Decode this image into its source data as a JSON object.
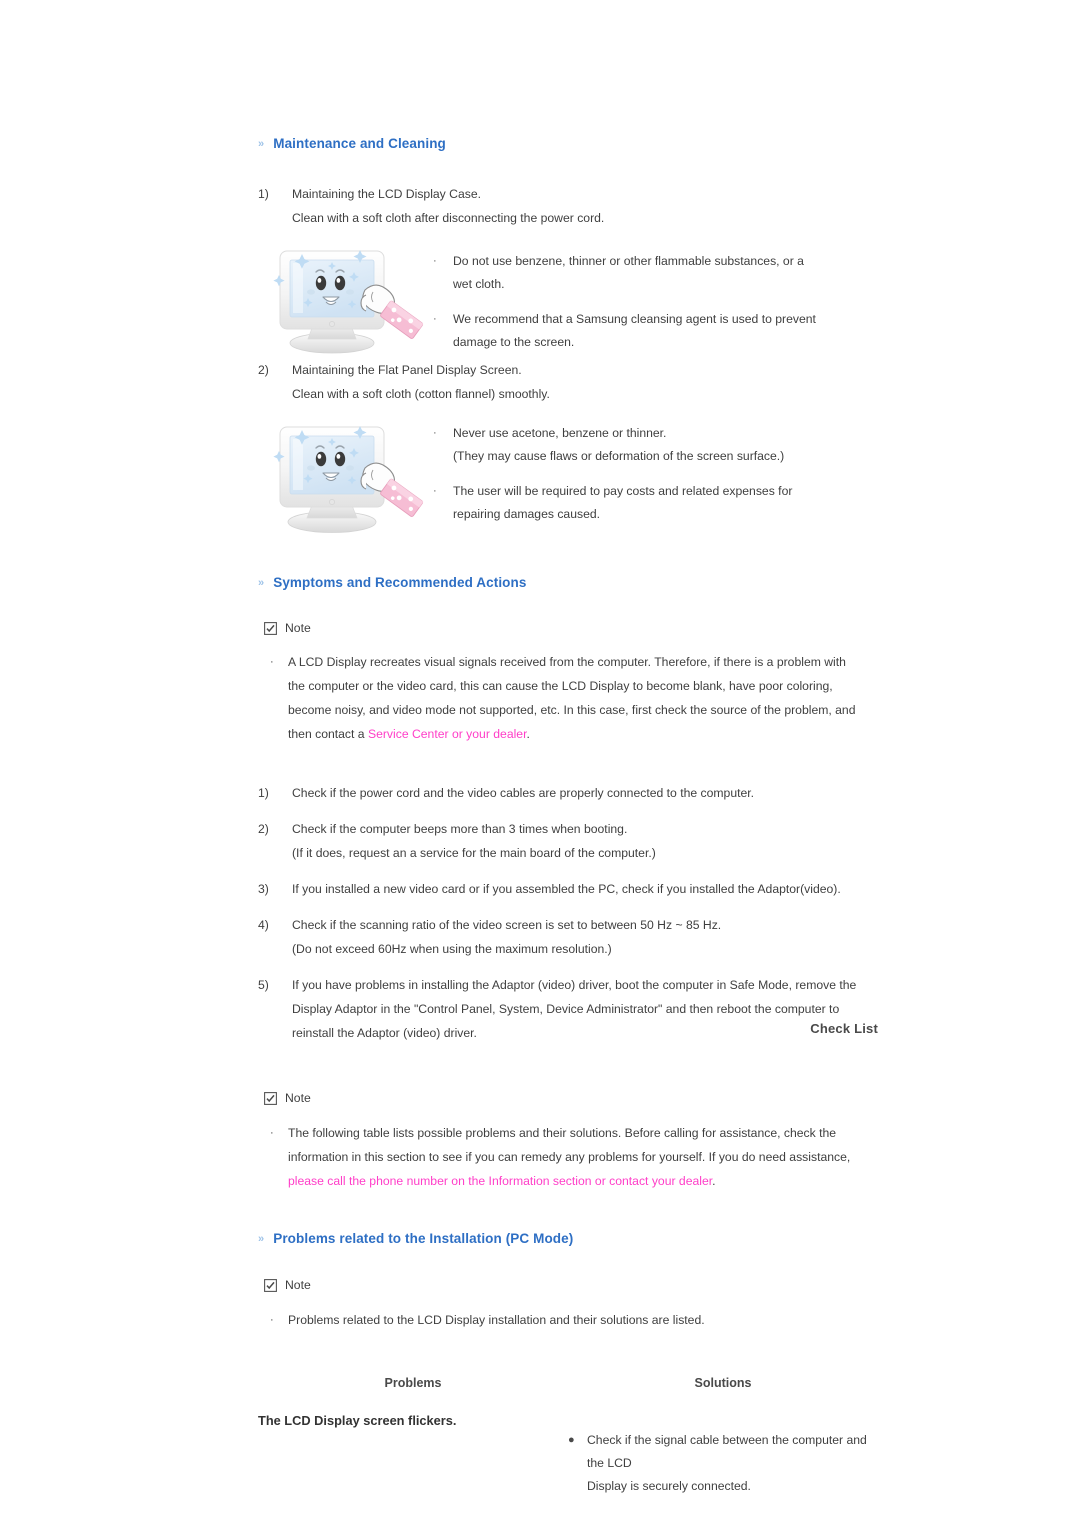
{
  "document": {
    "background_color": "#ffffff",
    "text_color": "#3f3f3f",
    "heading_color": "#2e6fc4",
    "chevron_color": "#9ec3e8",
    "link_color": "#ff3ec8",
    "chevron_glyph": "»",
    "bullet_glyph": "·",
    "filled_bullet_glyph": "●"
  },
  "sections": {
    "maintenance": {
      "heading": "Maintenance and Cleaning",
      "items": [
        {
          "number": "1)",
          "lines": [
            "Maintaining the LCD Display Case.",
            "Clean with a soft cloth after disconnecting the power cord."
          ]
        },
        {
          "number": "2)",
          "lines": [
            "Maintaining the Flat Panel Display Screen.",
            "Clean with a soft cloth (cotton flannel) smoothly."
          ]
        }
      ],
      "figure_1": {
        "icon_name": "monitor-cleaning-illustration",
        "screen_color": "#dbe9f6",
        "bezel_color": "#f2f2f2",
        "sparkle_color": "#cfe4f7",
        "cloth_color": "#f7c3d8",
        "bullets": [
          [
            "Do not use benzene, thinner or other flammable substances, or a",
            "wet cloth."
          ],
          [
            "We recommend that a Samsung cleansing agent is used to prevent",
            "damage to the screen."
          ]
        ]
      },
      "figure_2": {
        "icon_name": "monitor-cleaning-illustration",
        "screen_color": "#dbe9f6",
        "bezel_color": "#f2f2f2",
        "sparkle_color": "#cfe4f7",
        "cloth_color": "#f7c3d8",
        "bullets": [
          [
            "Never use acetone, benzene or thinner.",
            "(They may cause flaws or deformation of the screen surface.)"
          ],
          [
            "The user will be required to pay costs and related expenses for",
            "repairing damages caused."
          ]
        ]
      }
    },
    "symptoms": {
      "heading": "Symptoms and Recommended Actions",
      "note_label": "Note",
      "note_lines": [
        "A LCD Display recreates visual signals received from the computer. Therefore, if there is a problem with",
        "the computer or the video card, this can cause the LCD Display to become blank, have poor coloring,",
        "become noisy, and video mode not supported, etc. In this case, first check the source of the problem, and"
      ],
      "note_last_line_prefix": "then contact a ",
      "note_last_line_link": "Service Center or your dealer",
      "note_last_line_suffix": ".",
      "steps": [
        {
          "number": "1)",
          "lines": [
            "Check if the power cord and the video cables are properly connected to the computer."
          ]
        },
        {
          "number": "2)",
          "lines": [
            "Check if the computer beeps more than 3 times when booting.",
            "(If it does, request an a service for the main board of the computer.)"
          ]
        },
        {
          "number": "3)",
          "lines": [
            "If you installed a new video card or if you assembled the PC, check if you installed the Adaptor(video)."
          ]
        },
        {
          "number": "4)",
          "lines": [
            "Check if the scanning ratio of the video screen is set to between 50 Hz ~ 85 Hz.",
            "(Do not exceed 60Hz when using the maximum resolution.)"
          ]
        },
        {
          "number": "5)",
          "lines": [
            "If you have problems in installing the Adaptor (video) driver, boot the computer in Safe Mode, remove the",
            "Display Adaptor in the \"Control Panel, System, Device Administrator\" and then reboot the computer to",
            "reinstall the Adaptor (video) driver."
          ]
        }
      ]
    },
    "check_list": {
      "heading": "Check List",
      "note_label": "Note",
      "note_lines": [
        "The following table lists possible problems and their solutions. Before calling for assistance, check the",
        "information in this section to see if you can remedy any problems for yourself. If you do need assistance,"
      ],
      "note_link_line": "please call the phone number on the Information section or contact your dealer",
      "note_link_suffix": "."
    },
    "installation_problems": {
      "heading": "Problems related to the Installation (PC Mode)",
      "note_label": "Note",
      "note_lines": [
        "Problems related to the LCD Display installation and their solutions are listed."
      ],
      "table": {
        "columns": [
          "Problems",
          "Solutions"
        ],
        "rows": [
          {
            "problem": "The LCD Display screen flickers.",
            "solution_lines": [
              "Check if the signal cable between the computer and the LCD",
              "Display is securely connected."
            ]
          }
        ]
      }
    }
  }
}
